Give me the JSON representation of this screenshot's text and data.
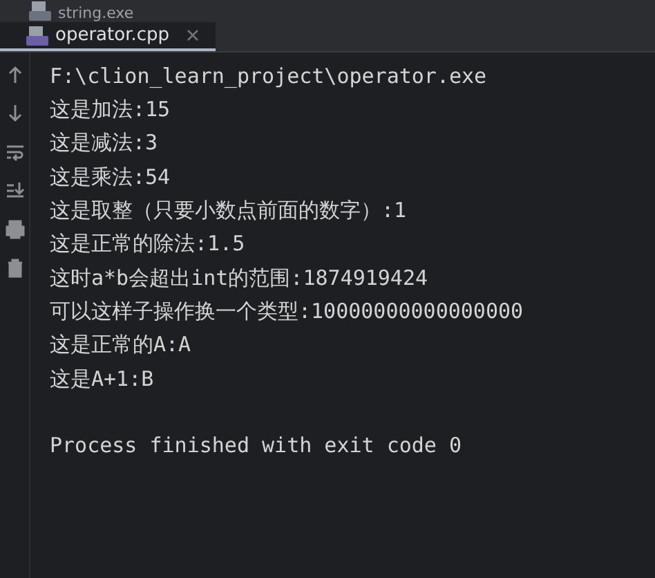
{
  "tabs": [
    {
      "label": "string.exe",
      "selected": false
    },
    {
      "label": "operator.cpp",
      "selected": true
    }
  ],
  "console": {
    "lines": [
      "F:\\clion_learn_project\\operator.exe",
      "这是加法:15",
      "这是减法:3",
      "这是乘法:54",
      "这是取整（只要小数点前面的数字）:1",
      "这是正常的除法:1.5",
      "这时a*b会超出int的范围:1874919424",
      "可以这样子操作换一个类型:10000000000000000",
      "这是正常的A:A",
      "这是A+1:B"
    ],
    "exit_message": "Process finished with exit code 0"
  }
}
